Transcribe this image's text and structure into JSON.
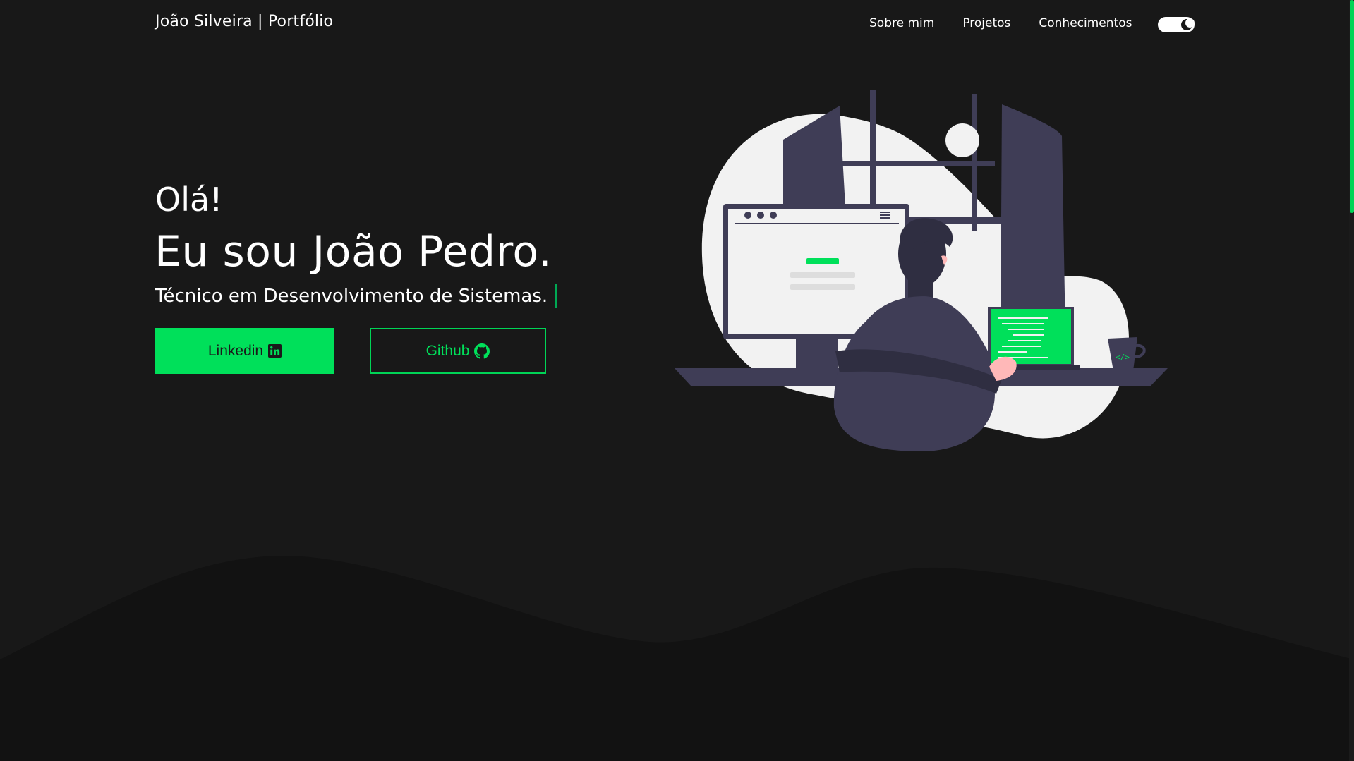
{
  "header": {
    "brand": "João Silveira | Portfólio",
    "nav": [
      {
        "label": "Sobre mim"
      },
      {
        "label": "Projetos"
      },
      {
        "label": "Conhecimentos"
      }
    ],
    "theme_toggle_icon": "moon-icon"
  },
  "hero": {
    "greeting": "Olá!",
    "name": "Eu sou João Pedro.",
    "role": "Técnico em Desenvolvimento de Sistemas.",
    "buttons": {
      "linkedin": {
        "label": "Linkedin",
        "icon": "linkedin-icon"
      },
      "github": {
        "label": "Github",
        "icon": "github-icon"
      }
    }
  },
  "colors": {
    "background": "#181818",
    "accent": "#00e05a",
    "wave": "#121212",
    "illustration_dark": "#3f3d56",
    "illustration_light": "#f2f2f2"
  }
}
